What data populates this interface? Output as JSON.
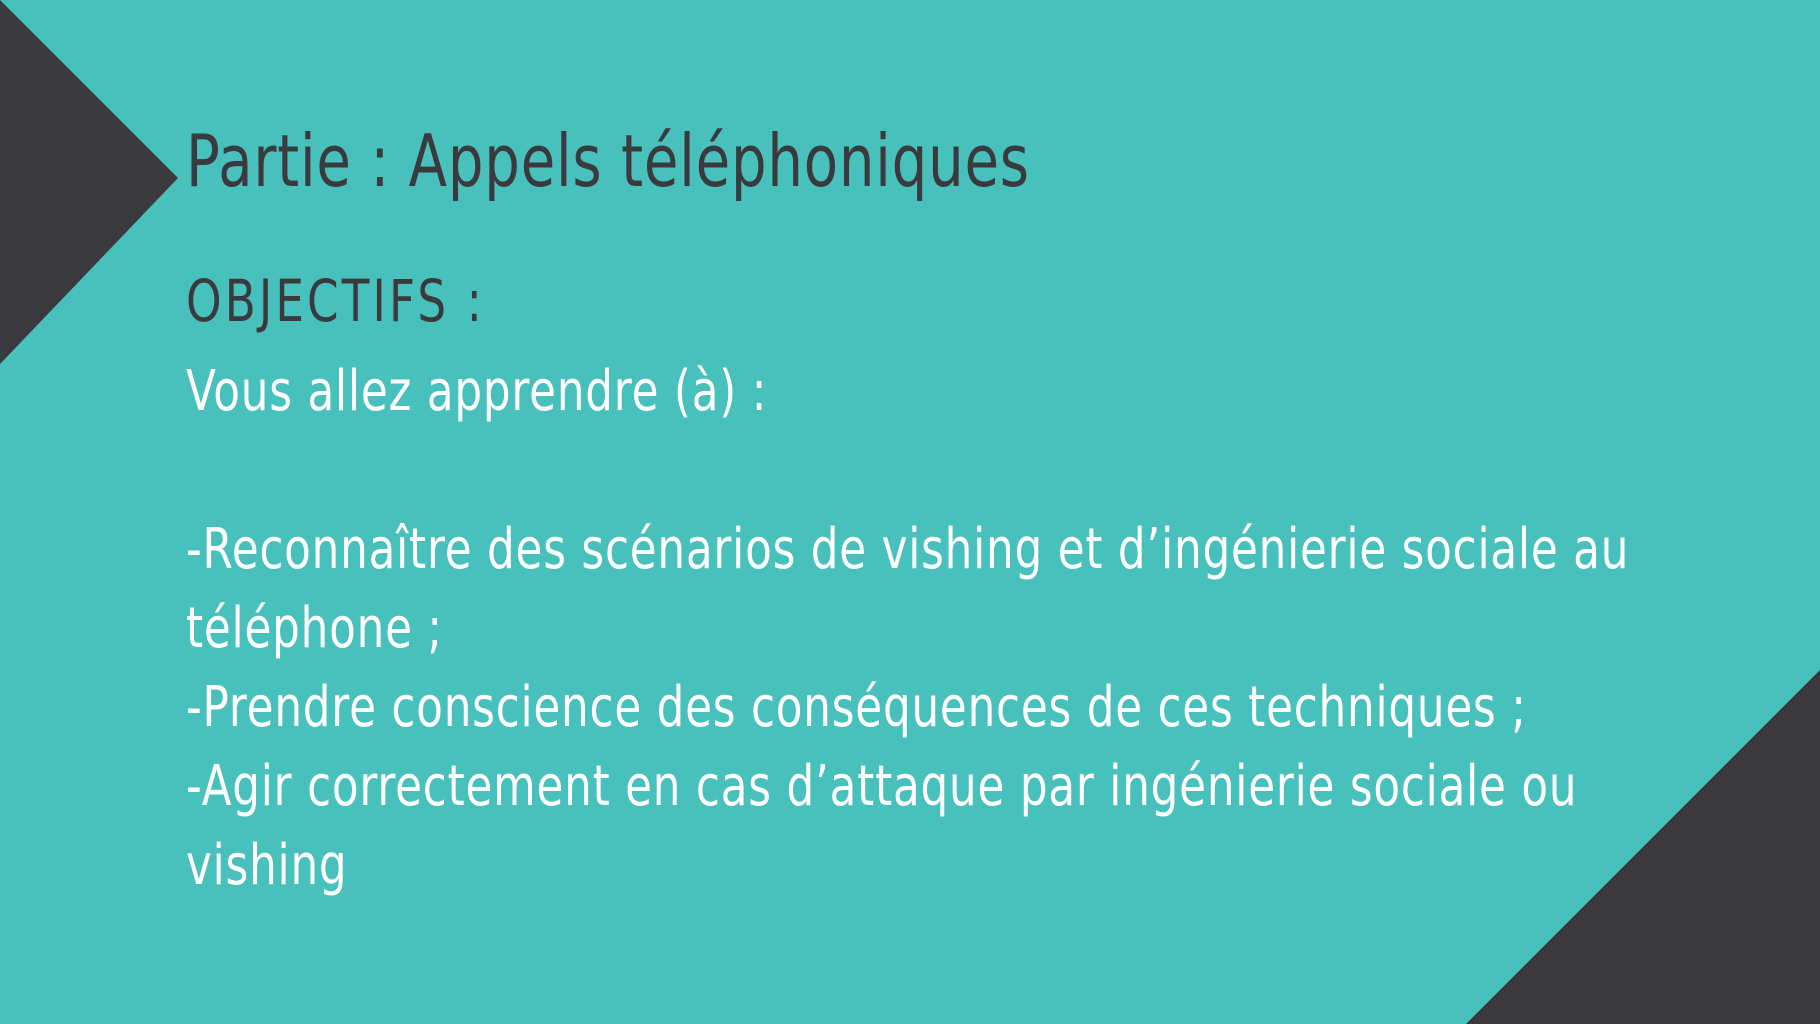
{
  "slide": {
    "title": "Partie : Appels téléphoniques",
    "subtitle": "OBJECTIFS :",
    "intro": "Vous allez apprendre (à) :",
    "objectives": [
      "-Reconnaître des scénarios de vishing et d’ingénierie sociale au téléphone ;",
      "-Prendre conscience des conséquences de ces techniques ;",
      "-Agir correctement en cas d’attaque par ingénierie sociale ou vishing"
    ]
  },
  "colors": {
    "background": "#48c0bc",
    "accent_dark": "#3a393e",
    "text_dark": "#3a393e",
    "text_light": "#ffffff"
  }
}
